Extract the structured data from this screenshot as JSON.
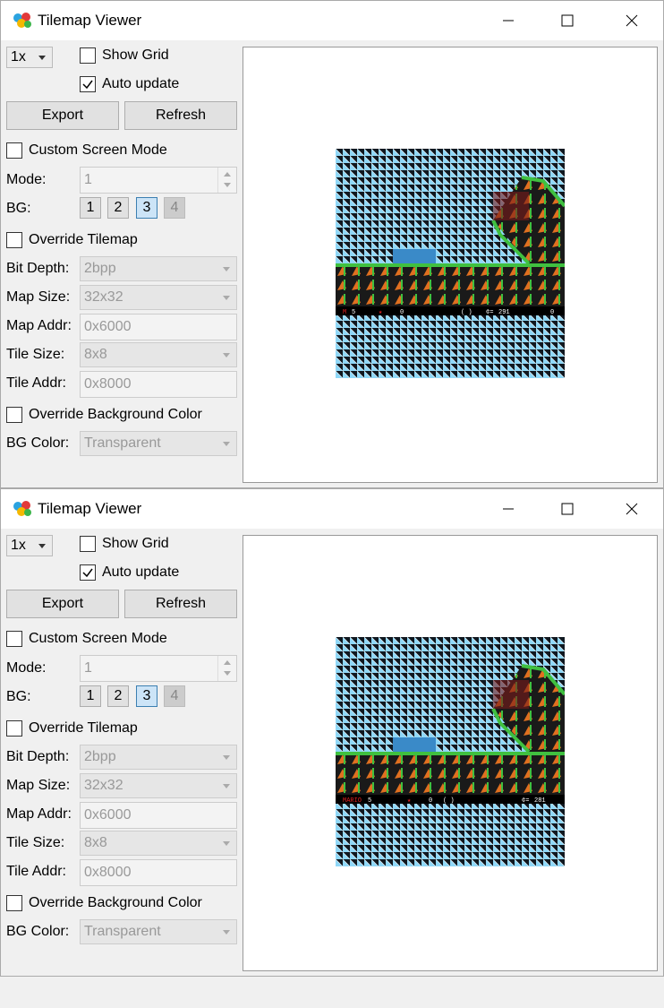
{
  "windows": [
    {
      "title": "Tilemap Viewer",
      "zoom": "1x",
      "show_grid_label": "Show Grid",
      "show_grid": false,
      "auto_update_label": "Auto update",
      "auto_update": true,
      "export_label": "Export",
      "refresh_label": "Refresh",
      "custom_mode_label": "Custom Screen Mode",
      "mode_label": "Mode:",
      "mode_value": "1",
      "bg_label": "BG:",
      "bg_buttons": [
        "1",
        "2",
        "3",
        "4"
      ],
      "bg_active": "3",
      "override_tilemap_label": "Override Tilemap",
      "bit_depth_label": "Bit Depth:",
      "bit_depth": "2bpp",
      "map_size_label": "Map Size:",
      "map_size": "32x32",
      "map_addr_label": "Map Addr:",
      "map_addr": "0x6000",
      "tile_size_label": "Tile Size:",
      "tile_size": "8x8",
      "tile_addr_label": "Tile Addr:",
      "tile_addr": "0x8000",
      "override_bg_label": "Override Background Color",
      "bg_color_label": "BG Color:",
      "bg_color": "Transparent",
      "hud": {
        "lives_label": "M",
        "lives": "5",
        "stars": "0",
        "coins": "291",
        "dragon_coins": "0"
      }
    },
    {
      "title": "Tilemap Viewer",
      "zoom": "1x",
      "show_grid_label": "Show Grid",
      "show_grid": false,
      "auto_update_label": "Auto update",
      "auto_update": true,
      "export_label": "Export",
      "refresh_label": "Refresh",
      "custom_mode_label": "Custom Screen Mode",
      "mode_label": "Mode:",
      "mode_value": "1",
      "bg_label": "BG:",
      "bg_buttons": [
        "1",
        "2",
        "3",
        "4"
      ],
      "bg_active": "3",
      "override_tilemap_label": "Override Tilemap",
      "bit_depth_label": "Bit Depth:",
      "bit_depth": "2bpp",
      "map_size_label": "Map Size:",
      "map_size": "32x32",
      "map_addr_label": "Map Addr:",
      "map_addr": "0x6000",
      "tile_size_label": "Tile Size:",
      "tile_size": "8x8",
      "tile_addr_label": "Tile Addr:",
      "tile_addr": "0x8000",
      "override_bg_label": "Override Background Color",
      "bg_color_label": "BG Color:",
      "bg_color": "Transparent",
      "hud": {
        "lives_label": "MARIO",
        "lives": "5",
        "stars": "0",
        "coins": "281",
        "dragon_coins": ""
      }
    }
  ],
  "colors": {
    "tile_cyan": "#8fd8f8",
    "tile_dark": "#101820",
    "ground_orange": "#e07020",
    "ground_green": "#40c040",
    "hud_red": "#e02020",
    "hud_white": "#ffffff",
    "button_active": "#cce4f7"
  }
}
